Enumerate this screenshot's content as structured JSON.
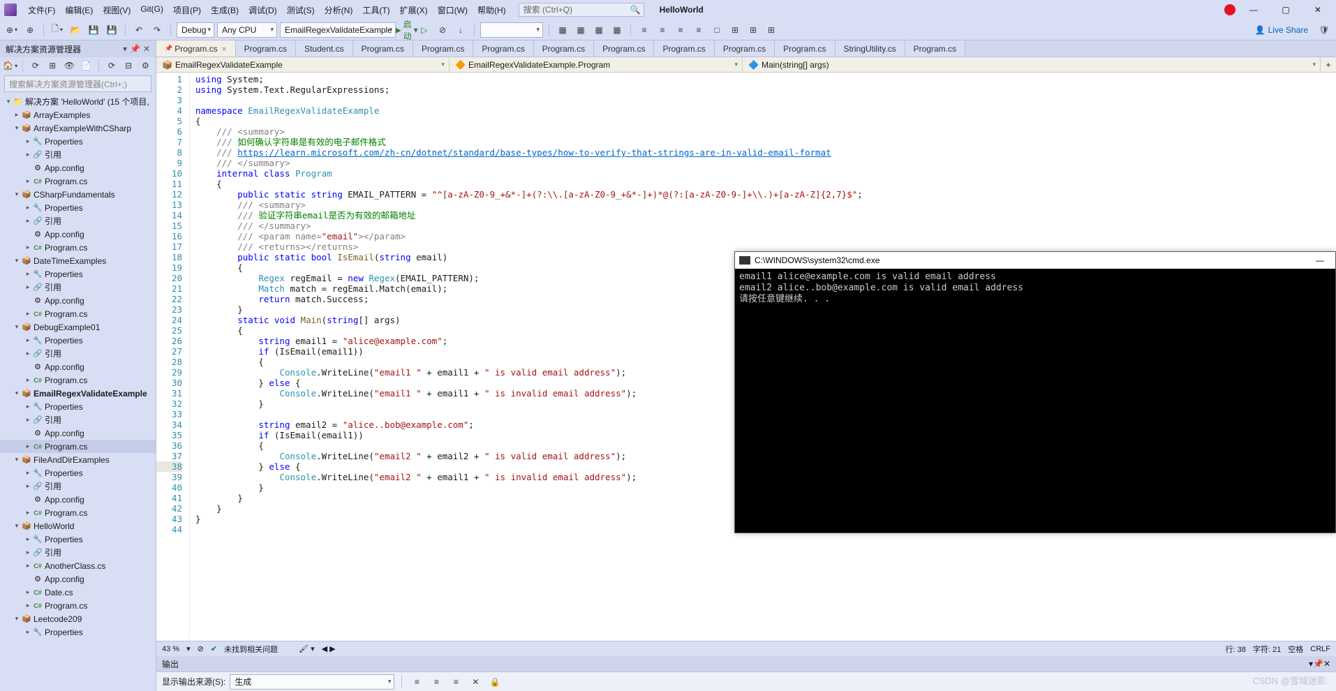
{
  "menus": [
    "文件(F)",
    "编辑(E)",
    "视图(V)",
    "Git(G)",
    "项目(P)",
    "生成(B)",
    "调试(D)",
    "测试(S)",
    "分析(N)",
    "工具(T)",
    "扩展(X)",
    "窗口(W)",
    "帮助(H)"
  ],
  "search_placeholder": "搜索 (Ctrl+Q)",
  "app_title": "HelloWorld",
  "combo_config": "Debug",
  "combo_platform": "Any CPU",
  "combo_startup": "EmailRegexValidateExample",
  "start_label": "启动",
  "liveshare": "Live Share",
  "sidebar_title": "解决方案资源管理器",
  "sidebar_search": "搜索解决方案资源管理器(Ctrl+;)",
  "solution_label": "解决方案 'HelloWorld' (15 个项目,",
  "tree": [
    {
      "d": 1,
      "t": "▸",
      "i": "📦",
      "l": "ArrayExamples"
    },
    {
      "d": 1,
      "t": "▾",
      "i": "📦",
      "l": "ArrayExampleWithCSharp"
    },
    {
      "d": 2,
      "t": "▸",
      "i": "🔧",
      "l": "Properties"
    },
    {
      "d": 2,
      "t": "▸",
      "i": "🔗",
      "l": "引用"
    },
    {
      "d": 2,
      "t": "",
      "i": "⚙",
      "l": "App.config"
    },
    {
      "d": 2,
      "t": "▸",
      "i": "C#",
      "l": "Program.cs"
    },
    {
      "d": 1,
      "t": "▾",
      "i": "📦",
      "l": "CSharpFundamentals"
    },
    {
      "d": 2,
      "t": "▸",
      "i": "🔧",
      "l": "Properties"
    },
    {
      "d": 2,
      "t": "▸",
      "i": "🔗",
      "l": "引用"
    },
    {
      "d": 2,
      "t": "",
      "i": "⚙",
      "l": "App.config"
    },
    {
      "d": 2,
      "t": "▸",
      "i": "C#",
      "l": "Program.cs"
    },
    {
      "d": 1,
      "t": "▾",
      "i": "📦",
      "l": "DateTimeExamples"
    },
    {
      "d": 2,
      "t": "▸",
      "i": "🔧",
      "l": "Properties"
    },
    {
      "d": 2,
      "t": "▸",
      "i": "🔗",
      "l": "引用"
    },
    {
      "d": 2,
      "t": "",
      "i": "⚙",
      "l": "App.config"
    },
    {
      "d": 2,
      "t": "▸",
      "i": "C#",
      "l": "Program.cs"
    },
    {
      "d": 1,
      "t": "▾",
      "i": "📦",
      "l": "DebugExample01"
    },
    {
      "d": 2,
      "t": "▸",
      "i": "🔧",
      "l": "Properties"
    },
    {
      "d": 2,
      "t": "▸",
      "i": "🔗",
      "l": "引用"
    },
    {
      "d": 2,
      "t": "",
      "i": "⚙",
      "l": "App.config"
    },
    {
      "d": 2,
      "t": "▸",
      "i": "C#",
      "l": "Program.cs"
    },
    {
      "d": 1,
      "t": "▾",
      "i": "📦",
      "l": "EmailRegexValidateExample",
      "bold": true
    },
    {
      "d": 2,
      "t": "▸",
      "i": "🔧",
      "l": "Properties"
    },
    {
      "d": 2,
      "t": "▸",
      "i": "🔗",
      "l": "引用"
    },
    {
      "d": 2,
      "t": "",
      "i": "⚙",
      "l": "App.config"
    },
    {
      "d": 2,
      "t": "▸",
      "i": "C#",
      "l": "Program.cs",
      "sel": true
    },
    {
      "d": 1,
      "t": "▾",
      "i": "📦",
      "l": "FileAndDirExamples"
    },
    {
      "d": 2,
      "t": "▸",
      "i": "🔧",
      "l": "Properties"
    },
    {
      "d": 2,
      "t": "▸",
      "i": "🔗",
      "l": "引用"
    },
    {
      "d": 2,
      "t": "",
      "i": "⚙",
      "l": "App.config"
    },
    {
      "d": 2,
      "t": "▸",
      "i": "C#",
      "l": "Program.cs"
    },
    {
      "d": 1,
      "t": "▾",
      "i": "📦",
      "l": "HelloWorld"
    },
    {
      "d": 2,
      "t": "▸",
      "i": "🔧",
      "l": "Properties"
    },
    {
      "d": 2,
      "t": "▸",
      "i": "🔗",
      "l": "引用"
    },
    {
      "d": 2,
      "t": "▸",
      "i": "C#",
      "l": "AnotherClass.cs"
    },
    {
      "d": 2,
      "t": "",
      "i": "⚙",
      "l": "App.config"
    },
    {
      "d": 2,
      "t": "▸",
      "i": "C#",
      "l": "Date.cs"
    },
    {
      "d": 2,
      "t": "▸",
      "i": "C#",
      "l": "Program.cs"
    },
    {
      "d": 1,
      "t": "▾",
      "i": "📦",
      "l": "Leetcode209"
    },
    {
      "d": 2,
      "t": "▸",
      "i": "🔧",
      "l": "Properties"
    }
  ],
  "tabs": [
    "Program.cs",
    "Program.cs",
    "Student.cs",
    "Program.cs",
    "Program.cs",
    "Program.cs",
    "Program.cs",
    "Program.cs",
    "Program.cs",
    "Program.cs",
    "Program.cs",
    "StringUtility.cs",
    "Program.cs"
  ],
  "nav1": "EmailRegexValidateExample",
  "nav2": "EmailRegexValidateExample.Program",
  "nav3": "Main(string[] args)",
  "code": [
    {
      "n": 1,
      "h": "<span class='kw'>using</span> System;"
    },
    {
      "n": 2,
      "h": "<span class='kw'>using</span> System.Text.RegularExpressions;"
    },
    {
      "n": 3,
      "h": ""
    },
    {
      "n": 4,
      "h": "<span class='kw'>namespace</span> <span class='type'>EmailRegexValidateExample</span>"
    },
    {
      "n": 5,
      "h": "{"
    },
    {
      "n": 6,
      "h": "    <span class='comx'>/// &lt;summary&gt;</span>"
    },
    {
      "n": 7,
      "h": "    <span class='comx'>///</span> <span class='com'>如何确认字符串是有效的电子邮件格式</span>"
    },
    {
      "n": 8,
      "h": "    <span class='comx'>///</span> <span class='link'>https://learn.microsoft.com/zh-cn/dotnet/standard/base-types/how-to-verify-that-strings-are-in-valid-email-format</span>"
    },
    {
      "n": 9,
      "h": "    <span class='comx'>/// &lt;/summary&gt;</span>"
    },
    {
      "n": 10,
      "h": "    <span class='kw'>internal class</span> <span class='type'>Program</span>"
    },
    {
      "n": 11,
      "h": "    {"
    },
    {
      "n": 12,
      "h": "        <span class='kw'>public static string</span> EMAIL_PATTERN = <span class='str'>\"^[a-zA-Z0-9_+&*-]+(?:\\\\.[a-zA-Z0-9_+&*-]+)*@(?:[a-zA-Z0-9-]+\\\\.)+[a-zA-Z]{2,7}$\"</span>;"
    },
    {
      "n": 13,
      "h": "        <span class='comx'>/// &lt;summary&gt;</span>"
    },
    {
      "n": 14,
      "h": "        <span class='comx'>///</span> <span class='com'>验证字符串email是否为有效的邮箱地址</span>"
    },
    {
      "n": 15,
      "h": "        <span class='comx'>/// &lt;/summary&gt;</span>"
    },
    {
      "n": 16,
      "h": "        <span class='comx'>/// &lt;param name=</span><span class='str'>\"email\"</span><span class='comx'>&gt;&lt;/param&gt;</span>"
    },
    {
      "n": 17,
      "h": "        <span class='comx'>/// &lt;returns&gt;&lt;/returns&gt;</span>"
    },
    {
      "n": 18,
      "h": "        <span class='kw'>public static bool</span> <span style='color:#795e26'>IsEmail</span>(<span class='kw'>string</span> email)"
    },
    {
      "n": 19,
      "h": "        {"
    },
    {
      "n": 20,
      "h": "            <span class='type'>Regex</span> regEmail = <span class='kw'>new</span> <span class='type'>Regex</span>(EMAIL_PATTERN);"
    },
    {
      "n": 21,
      "h": "            <span class='type'>Match</span> match = regEmail.Match(email);"
    },
    {
      "n": 22,
      "h": "            <span class='kw'>return</span> match.Success;"
    },
    {
      "n": 23,
      "h": "        }"
    },
    {
      "n": 24,
      "h": "        <span class='kw'>static void</span> <span style='color:#795e26'>Main</span>(<span class='kw'>string</span>[] args)"
    },
    {
      "n": 25,
      "h": "        {"
    },
    {
      "n": 26,
      "h": "            <span class='kw'>string</span> email1 = <span class='str'>\"alice@example.com\"</span>;"
    },
    {
      "n": 27,
      "h": "            <span class='kw'>if</span> (IsEmail(email1))"
    },
    {
      "n": 28,
      "h": "            {"
    },
    {
      "n": 29,
      "h": "                <span class='type'>Console</span>.WriteLine(<span class='str'>\"email1 \"</span> + email1 + <span class='str'>\" is valid email address\"</span>);"
    },
    {
      "n": 30,
      "h": "            } <span class='kw'>else</span> {"
    },
    {
      "n": 31,
      "h": "                <span class='type'>Console</span>.WriteLine(<span class='str'>\"email1 \"</span> + email1 + <span class='str'>\" is invalid email address\"</span>);"
    },
    {
      "n": 32,
      "h": "            }"
    },
    {
      "n": 33,
      "h": ""
    },
    {
      "n": 34,
      "h": "            <span class='kw'>string</span> email2 = <span class='str'>\"alice..bob@example.com\"</span>;"
    },
    {
      "n": 35,
      "h": "            <span class='kw'>if</span> (IsEmail(email1))"
    },
    {
      "n": 36,
      "h": "            {"
    },
    {
      "n": 37,
      "h": "                <span class='type'>Console</span>.WriteLine(<span class='str'>\"email2 \"</span> + email2 + <span class='str'>\" is valid email address\"</span>);"
    },
    {
      "n": 38,
      "h": "            } <span class='kw'>else</span> {",
      "cur": true
    },
    {
      "n": 39,
      "h": "                <span class='type'>Console</span>.WriteLine(<span class='str'>\"email2 \"</span> + email1 + <span class='str'>\" is invalid email address\"</span>);"
    },
    {
      "n": 40,
      "h": "            }"
    },
    {
      "n": 41,
      "h": "        }"
    },
    {
      "n": 42,
      "h": "    }"
    },
    {
      "n": 43,
      "h": "}"
    },
    {
      "n": 44,
      "h": ""
    }
  ],
  "zoom": "43 %",
  "no_issues": "未找到相关问题",
  "status_line": "行: 38",
  "status_char": "字符: 21",
  "status_spc": "空格",
  "status_crlf": "CRLF",
  "output_title": "输出",
  "output_source_lbl": "显示输出来源(S):",
  "output_source_val": "生成",
  "cmd_title": "C:\\WINDOWS\\system32\\cmd.exe",
  "cmd_lines": [
    "email1 alice@example.com is valid email address",
    "email2 alice..bob@example.com is valid email address",
    "请按任意键继续. . ."
  ],
  "watermark": "CSDN @雪域迷影"
}
